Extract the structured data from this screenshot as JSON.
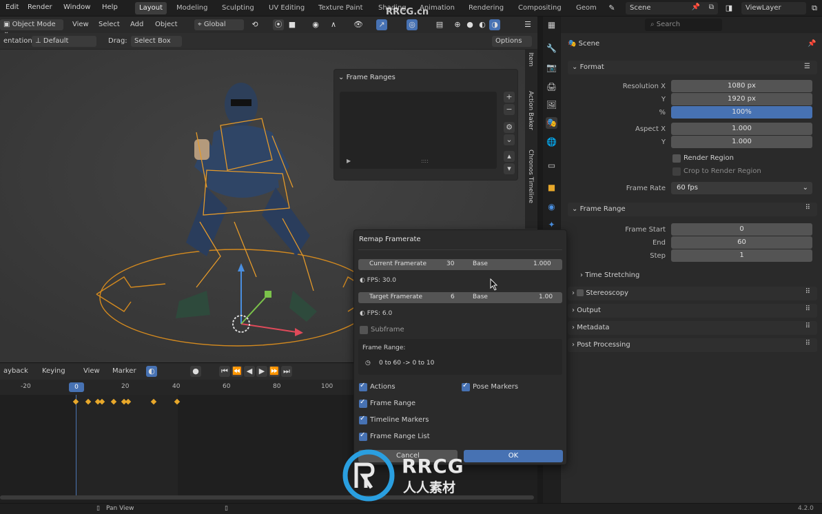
{
  "topbar": {
    "menus": [
      "Edit",
      "Render",
      "Window",
      "Help"
    ],
    "workspaces": [
      "Layout",
      "Modeling",
      "Sculpting",
      "UV Editing",
      "Texture Paint",
      "Shading",
      "Animation",
      "Rendering",
      "Compositing",
      "Geom"
    ],
    "active_workspace": "Layout",
    "scene": "Scene",
    "view_layer": "ViewLayer"
  },
  "viewport": {
    "mode": "Object Mode",
    "menus": [
      "View",
      "Select",
      "Add",
      "Object"
    ],
    "transform_orientation": "Global",
    "orientation_label": "entation:",
    "orientation_value": "Default",
    "drag_label": "Drag:",
    "drag_value": "Select Box",
    "options_label": "Options"
  },
  "frame_ranges_panel": {
    "title": "Frame Ranges",
    "list_footer": "::::"
  },
  "side_tabs": [
    "Item",
    "Action Baker",
    "Chronos Timeline"
  ],
  "timeline": {
    "menus": [
      "ayback",
      "Keying",
      "View",
      "Marker"
    ],
    "current_frame": "0",
    "ticks": [
      "-20",
      "0",
      "20",
      "40",
      "60",
      "80",
      "100"
    ],
    "keyframe_positions": [
      110,
      128,
      142,
      148,
      165,
      180,
      186,
      223,
      257
    ]
  },
  "properties": {
    "search_placeholder": "Search",
    "context": "Scene",
    "format": {
      "title": "Format",
      "resolution_x_label": "Resolution X",
      "resolution_x": "1080 px",
      "resolution_y_label": "Y",
      "resolution_y": "1920 px",
      "percent_label": "%",
      "percent": "100%",
      "aspect_x_label": "Aspect X",
      "aspect_x": "1.000",
      "aspect_y_label": "Y",
      "aspect_y": "1.000",
      "render_region": "Render Region",
      "crop_region": "Crop to Render Region",
      "frame_rate_label": "Frame Rate",
      "frame_rate": "60 fps"
    },
    "frame_range": {
      "title": "Frame Range",
      "start_label": "Frame Start",
      "start": "0",
      "end_label": "End",
      "end": "60",
      "step_label": "Step",
      "step": "1",
      "time_stretching": "Time Stretching"
    },
    "collapsed_sections": [
      "Stereoscopy",
      "Output",
      "Metadata",
      "Post Processing"
    ]
  },
  "remap_dialog": {
    "title": "Remap Framerate",
    "current_label": "Current Framerate",
    "current_value": "30",
    "base_label": "Base",
    "current_base": "1.000",
    "fps_current": "FPS: 30.0",
    "target_label": "Target Framerate",
    "target_value": "6",
    "target_base": "1.00",
    "fps_target": "FPS: 6.0",
    "subframe": "Subframe",
    "frame_range_header": "Frame Range:",
    "frame_range_text": "0 to 60 -> 0 to 10",
    "actions": "Actions",
    "pose_markers": "Pose Markers",
    "frame_range_cb": "Frame Range",
    "timeline_markers": "Timeline Markers",
    "frame_range_list": "Frame Range List",
    "cancel": "Cancel",
    "ok": "OK"
  },
  "statusbar": {
    "hint": "Pan View",
    "version": "4.2.0"
  },
  "watermark": {
    "text_top": "RRCG",
    "text_bottom": "人人素材",
    "corner": "RRCG.cn"
  },
  "colors": {
    "accent": "#4772b3",
    "selection": "#e8a82b",
    "panel": "#2b2b2b"
  }
}
